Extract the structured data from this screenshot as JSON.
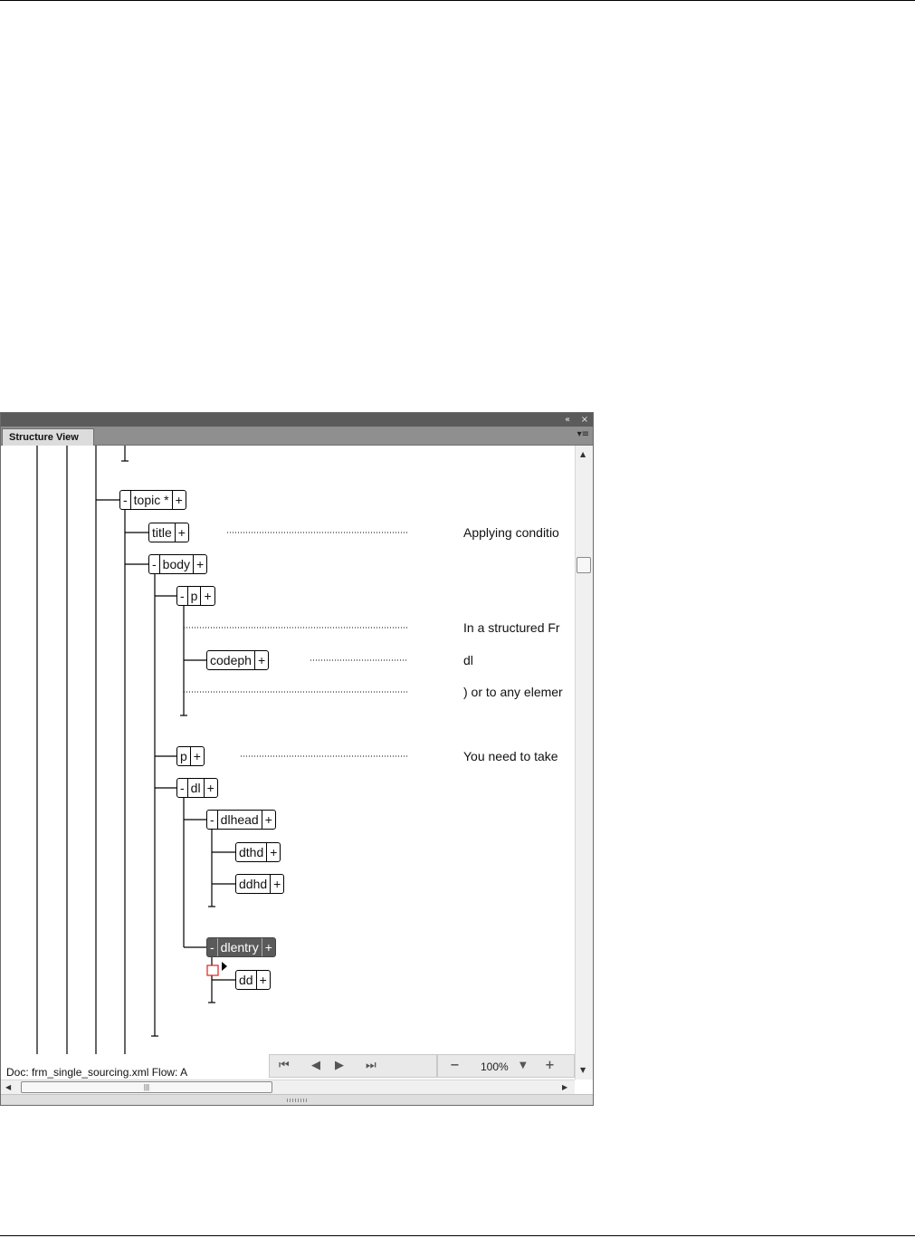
{
  "panel": {
    "title": "Structure View",
    "collapse_icon": "double-chevron-left-icon",
    "close_icon": "close-icon",
    "menu_icon": "panel-menu-icon"
  },
  "tree": {
    "nodes": [
      {
        "id": "topic",
        "label": "topic *",
        "expanded": true,
        "selected": false
      },
      {
        "id": "title",
        "label": "title",
        "expanded": false,
        "selected": false
      },
      {
        "id": "body",
        "label": "body",
        "expanded": true,
        "selected": false
      },
      {
        "id": "p1",
        "label": "p",
        "expanded": true,
        "selected": false
      },
      {
        "id": "codeph",
        "label": "codeph",
        "expanded": false,
        "selected": false
      },
      {
        "id": "p2",
        "label": "p",
        "expanded": false,
        "selected": false
      },
      {
        "id": "dl",
        "label": "dl",
        "expanded": true,
        "selected": false
      },
      {
        "id": "dlhead",
        "label": "dlhead",
        "expanded": true,
        "selected": false
      },
      {
        "id": "dthd",
        "label": "dthd",
        "expanded": false,
        "selected": false
      },
      {
        "id": "ddhd",
        "label": "ddhd",
        "expanded": false,
        "selected": false
      },
      {
        "id": "dlentry",
        "label": "dlentry",
        "expanded": true,
        "selected": true
      },
      {
        "id": "dd",
        "label": "dd",
        "expanded": false,
        "selected": false
      }
    ],
    "collapse_symbol": "-",
    "expand_symbol": "+",
    "snippets": {
      "title": "Applying conditio",
      "p1_text1": "In a structured Fr",
      "codeph": "dl",
      "p1_text2": ") or to any elemer",
      "p2": "You need to take"
    }
  },
  "status": {
    "doc": "Doc: frm_single_sourcing.xml Flow: A",
    "zoom": "100%",
    "nav_icons": [
      "first-page-icon",
      "previous-page-icon",
      "next-page-icon",
      "last-page-icon"
    ],
    "zoom_out_icon": "zoom-out-icon",
    "zoom_in_icon": "zoom-in-icon"
  },
  "colors": {
    "titlebar": "#5b5b5b",
    "tab": "#dcdcdc",
    "selected_node": "#5a5a5a",
    "missing_element_marker": "#e02020"
  }
}
